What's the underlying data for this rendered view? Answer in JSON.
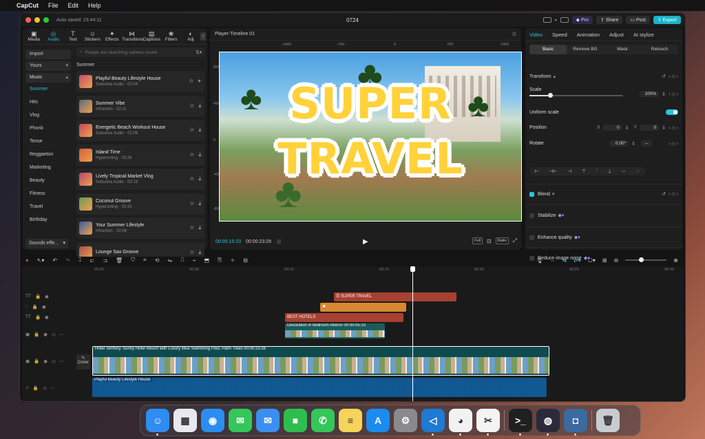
{
  "menubar": {
    "items": [
      "CapCut",
      "File",
      "Edit",
      "Help"
    ],
    "input_source": "US"
  },
  "window": {
    "autosave": "Auto saved: 23:44:11",
    "title": "0724",
    "buttons": {
      "pro": "Pro",
      "share": "Share",
      "post": "Post",
      "export": "Export"
    }
  },
  "toolbar": {
    "tools": [
      {
        "label": "Media",
        "icon": "media-icon",
        "glyph": "▣"
      },
      {
        "label": "Audio",
        "icon": "audio-icon",
        "glyph": "◎"
      },
      {
        "label": "Text",
        "icon": "text-icon",
        "glyph": "T"
      },
      {
        "label": "Stickers",
        "icon": "stickers-icon",
        "glyph": "☺"
      },
      {
        "label": "Effects",
        "icon": "effects-icon",
        "glyph": "✦"
      },
      {
        "label": "Transitions",
        "icon": "transitions-icon",
        "glyph": "⋈"
      },
      {
        "label": "Captions",
        "icon": "captions-icon",
        "glyph": "▤"
      },
      {
        "label": "Filters",
        "icon": "filters-icon",
        "glyph": "❀"
      },
      {
        "label": "Adj",
        "icon": "adjust-icon",
        "glyph": "◐"
      }
    ]
  },
  "sidebar": {
    "import": "Import",
    "yours": "Yours",
    "music": "Music",
    "categories": [
      "Summer",
      "Hits",
      "Vlog",
      "Phonk",
      "Tense",
      "Reggaeton",
      "Marketing",
      "Beauty",
      "Fitness",
      "Travel",
      "Birthday"
    ],
    "sounds_effects": "Sounds effe..."
  },
  "library": {
    "search_placeholder": "People are searching camera sound",
    "section": "Summer",
    "tracks": [
      {
        "title": "Playful Beauty Lifestyle House",
        "meta": "Suburbia Audio · 02:04",
        "color": "#c0506a",
        "second": "add"
      },
      {
        "title": "Summer Vibe",
        "meta": "Infraction · 02:11",
        "color": "#5a6a80",
        "second": "download"
      },
      {
        "title": "Energetic Beach Workout House",
        "meta": "Suburbia Audio · 02:08",
        "color": "#c04a5a",
        "second": "download"
      },
      {
        "title": "Island Time",
        "meta": "Hypersnting · 03:26",
        "color": "#d0603a",
        "second": "download"
      },
      {
        "title": "Lively Tropical Market Vlog",
        "meta": "Suburbia Audio · 02:19",
        "color": "#b04a6a",
        "second": "download"
      },
      {
        "title": "Coconut Groove",
        "meta": "Hypersnting · 03:23",
        "color": "#6a9a5a",
        "second": "download"
      },
      {
        "title": "Your Summer Lifestyle",
        "meta": "Infraction · 02:06",
        "color": "#3a5aa0",
        "second": "download"
      },
      {
        "title": "Lounge Sax Groove",
        "meta": "",
        "color": "#a05050",
        "second": "download"
      }
    ]
  },
  "player": {
    "title": "Player-Timeline 01",
    "ruler_h": [
      "-1400",
      "-700",
      "0",
      "700",
      "1400"
    ],
    "ruler_v": [
      "800",
      "400",
      "0",
      "-400",
      "-800"
    ],
    "overlay_line1": "SUPER",
    "overlay_line2": "TRAVEL",
    "time_current": "00:00:15:23",
    "time_total": "00:00:23:28",
    "btn_full": "Full",
    "btn_ratio": "Ratio"
  },
  "inspector": {
    "tabs": [
      "Video",
      "Speed",
      "Animation",
      "Adjust",
      "AI stylize"
    ],
    "subtabs": [
      "Basic",
      "Remove BG",
      "Mask",
      "Retouch"
    ],
    "transform": "Transform",
    "scale_label": "Scale",
    "scale_value": "100%",
    "scale_fraction": 0.22,
    "uniform_scale": "Uniform scale",
    "position_label": "Position",
    "pos_x_label": "X",
    "pos_x": "0",
    "pos_y_label": "Y",
    "pos_y": "0",
    "rotate_label": "Rotate",
    "rotate_value": "0.00°",
    "rotate_btn": "–",
    "blend": "Blend",
    "stabilize": "Stabilize",
    "enhance_quality": "Enhance quality",
    "reduce_noise": "Reduce image noise"
  },
  "timeline": {
    "ruler": [
      "00:00",
      "00:05",
      "00:10",
      "00:15",
      "00:20",
      "00:25",
      "00:30"
    ],
    "clips": {
      "super_travel": "SUPER TRAVEL",
      "best_hotels": "BEST HOTELS",
      "decoration": "Decoration in bedroom interior  00:00:05:10",
      "main": "Hotel Territory. Sunny Hotel Resort with Luxury Blue Swimming Pool, Palm Trees   00:00:23:28",
      "audio": "Playful Beauty Lifestyle House"
    },
    "cover": "Cover"
  },
  "dock": {
    "apps": [
      {
        "name": "finder",
        "color": "#2f8cf0",
        "glyph": "☺"
      },
      {
        "name": "launchpad",
        "color": "#e8e8ee",
        "glyph": "▦"
      },
      {
        "name": "safari",
        "color": "#2a8ef0",
        "glyph": "◉"
      },
      {
        "name": "messages",
        "color": "#34c759",
        "glyph": "✉"
      },
      {
        "name": "mail",
        "color": "#3a8ff0",
        "glyph": "✉"
      },
      {
        "name": "facetime",
        "color": "#2dbe4e",
        "glyph": "■"
      },
      {
        "name": "phone",
        "color": "#34c759",
        "glyph": "✆"
      },
      {
        "name": "notes",
        "color": "#f6d35a",
        "glyph": "≡"
      },
      {
        "name": "app-store",
        "color": "#1a8cf0",
        "glyph": "A"
      },
      {
        "name": "system-settings",
        "color": "#8a8a8e",
        "glyph": "⚙"
      },
      {
        "name": "vscode",
        "color": "#1e7ad2",
        "glyph": "◁"
      },
      {
        "name": "chrome",
        "color": "#f2f2f2",
        "glyph": "◕"
      },
      {
        "name": "capcut",
        "color": "#f4f4f4",
        "glyph": "✂"
      },
      {
        "name": "terminal",
        "color": "#202020",
        "glyph": ">_"
      },
      {
        "name": "obs",
        "color": "#2a2a3a",
        "glyph": "◍"
      },
      {
        "name": "disk-utility",
        "color": "#3a6aa0",
        "glyph": "◘"
      },
      {
        "name": "trash",
        "color": "#c8ccd0",
        "glyph": "🗑"
      }
    ]
  }
}
